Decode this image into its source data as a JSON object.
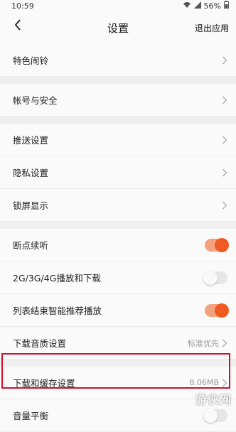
{
  "status_bar": {
    "time": "10:59",
    "battery": "56%"
  },
  "nav": {
    "title": "设置",
    "exit_label": "退出应用"
  },
  "sections": {
    "s1": {
      "special_alarm": "特色闹铃"
    },
    "s2": {
      "account_security": "帐号与安全"
    },
    "s3": {
      "push_settings": "推送设置",
      "privacy_settings": "隐私设置",
      "lockscreen_display": "锁屏显示"
    },
    "s4": {
      "resume_play": {
        "label": "断点续听",
        "on": true
      },
      "mobile_data": {
        "label": "2G/3G/4G播放和下载",
        "on": false
      },
      "smart_recommend": {
        "label": "列表结束智能推荐播放",
        "on": true
      },
      "download_quality": {
        "label": "下载音质设置",
        "value": "标准优先"
      },
      "download_cache": {
        "label": "下载和缓存设置",
        "value": "8.06MB"
      },
      "volume_balance": {
        "label": "音量平衡",
        "on": false
      }
    }
  },
  "watermark": "游侠网",
  "colors": {
    "accent": "#f05a23",
    "highlight_border": "#d0112b"
  }
}
